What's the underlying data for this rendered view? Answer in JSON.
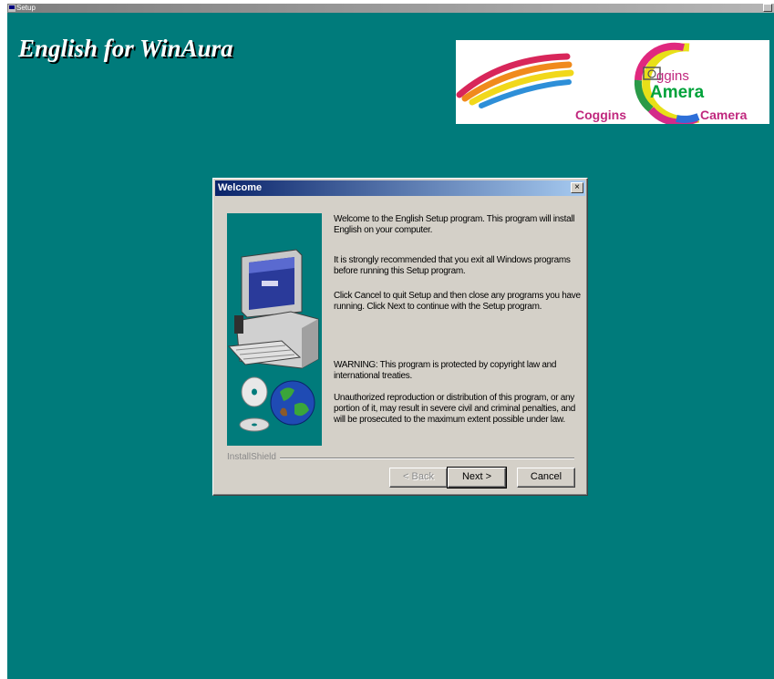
{
  "window": {
    "title": "Setup",
    "heading": "English for WinAura"
  },
  "logo": {
    "oggins": "ggins",
    "amera": "Amera",
    "coggins": "Coggins",
    "camera": "Camera"
  },
  "dialog": {
    "title": "Welcome",
    "close_label": "×",
    "paragraphs": [
      "Welcome to the English Setup program.  This program will install English on your computer.",
      "It is strongly recommended that you exit all Windows programs before running this Setup program.",
      "Click Cancel to quit Setup and then close any programs you have running.  Click Next to continue with the Setup program.",
      "WARNING: This program is protected by copyright law and international treaties.",
      "Unauthorized reproduction or distribution of this program, or any portion of it, may result in severe civil and criminal penalties, and will be prosecuted to the maximum extent possible under law."
    ],
    "separator_label": "InstallShield",
    "buttons": {
      "back": "< Back",
      "next": "Next >",
      "cancel": "Cancel"
    }
  },
  "colors": {
    "desktop": "#007b7b",
    "dialog_face": "#d4d0c8",
    "title_gradient_start": "#0a246a",
    "title_gradient_end": "#a6caf0"
  }
}
